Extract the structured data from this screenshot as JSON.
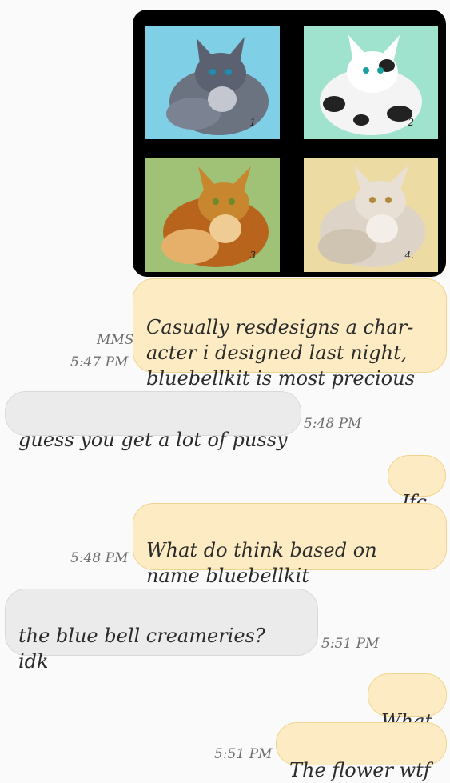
{
  "thread": {
    "image": {
      "alt_icon": "image-icon",
      "panels": [
        {
          "number": "1",
          "bg": "#7fcfe6"
        },
        {
          "number": "2",
          "bg": "#9fe3cf"
        },
        {
          "number": "3",
          "bg": "#9fc277"
        },
        {
          "number": "4.",
          "bg": "#ecdba3"
        }
      ]
    },
    "messages": [
      {
        "kind": "outgoing",
        "text": "Casually resdesigns a char-\nacter i designed last night,\nbluebellkit is most precious",
        "tag": "MMS",
        "time": "5:47 PM"
      },
      {
        "kind": "incoming",
        "text": "guess you get a lot of pussy",
        "time": "5:48 PM"
      },
      {
        "kind": "outgoing",
        "text": "Jfc"
      },
      {
        "kind": "outgoing",
        "text": "What do think based on\nname bluebellkit",
        "time": "5:48 PM"
      },
      {
        "kind": "incoming",
        "text": "the blue bell creameries?\nidk",
        "time": "5:51 PM"
      },
      {
        "kind": "outgoing",
        "text": "What"
      },
      {
        "kind": "outgoing",
        "text": "The flower wtf",
        "time": "5:51 PM"
      }
    ]
  },
  "colors": {
    "outgoing_bubble": "#fdecc3",
    "outgoing_border": "#f0d48f",
    "incoming_bubble": "#ebebeb",
    "background": "#fafafa"
  }
}
